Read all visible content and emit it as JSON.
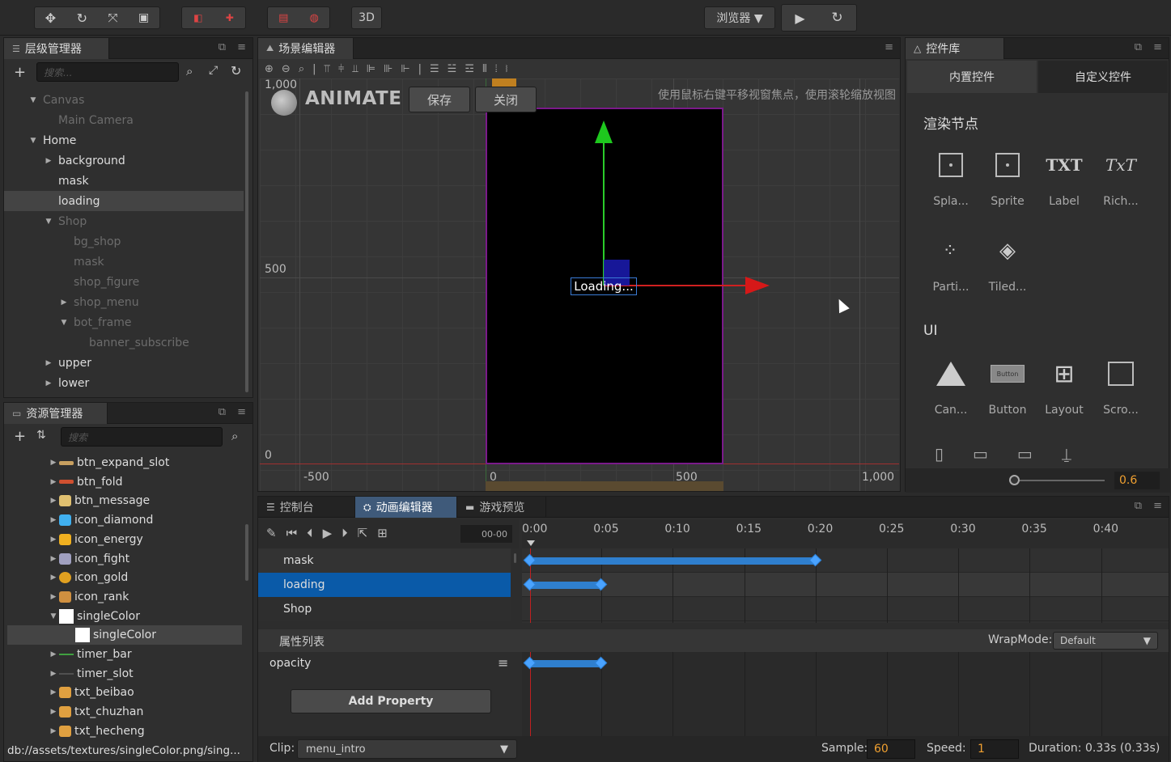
{
  "toolbar": {
    "view_3d": "3D",
    "browser_label": "浏览器 ▼"
  },
  "hierarchy": {
    "title": "层级管理器",
    "search_placeholder": "搜索...",
    "nodes": [
      {
        "label": "Canvas",
        "indent": 1,
        "arrow": "down",
        "dim": true
      },
      {
        "label": "Main Camera",
        "indent": 2,
        "arrow": "",
        "dim": true
      },
      {
        "label": "Home",
        "indent": 1,
        "arrow": "down",
        "dim": false
      },
      {
        "label": "background",
        "indent": 2,
        "arrow": "right",
        "dim": false
      },
      {
        "label": "mask",
        "indent": 2,
        "arrow": "",
        "dim": false
      },
      {
        "label": "loading",
        "indent": 2,
        "arrow": "",
        "dim": false,
        "selected": true
      },
      {
        "label": "Shop",
        "indent": 2,
        "arrow": "down",
        "dim": true
      },
      {
        "label": "bg_shop",
        "indent": 3,
        "arrow": "",
        "dim": true
      },
      {
        "label": "mask",
        "indent": 3,
        "arrow": "",
        "dim": true
      },
      {
        "label": "shop_figure",
        "indent": 3,
        "arrow": "",
        "dim": true
      },
      {
        "label": "shop_menu",
        "indent": 3,
        "arrow": "right",
        "dim": true
      },
      {
        "label": "bot_frame",
        "indent": 3,
        "arrow": "down",
        "dim": true
      },
      {
        "label": "banner_subscribe",
        "indent": 4,
        "arrow": "",
        "dim": true
      },
      {
        "label": "upper",
        "indent": 2,
        "arrow": "right",
        "dim": false
      },
      {
        "label": "lower",
        "indent": 2,
        "arrow": "right",
        "dim": false
      }
    ]
  },
  "assets": {
    "title": "资源管理器",
    "search_placeholder": "搜索",
    "items": [
      {
        "label": "btn_expand_slot",
        "icon": "bar",
        "color": "#c8a060"
      },
      {
        "label": "btn_fold",
        "icon": "bar",
        "color": "#d05030"
      },
      {
        "label": "btn_message",
        "icon": "box",
        "color": "#e0c070"
      },
      {
        "label": "icon_diamond",
        "icon": "gem",
        "color": "#40b0f0"
      },
      {
        "label": "icon_energy",
        "icon": "bolt",
        "color": "#f0b020"
      },
      {
        "label": "icon_fight",
        "icon": "sword",
        "color": "#a0a0c0"
      },
      {
        "label": "icon_gold",
        "icon": "coin",
        "color": "#e0a020"
      },
      {
        "label": "icon_rank",
        "icon": "crown",
        "color": "#d09040"
      },
      {
        "label": "singleColor",
        "icon": "white",
        "color": "#ffffff",
        "arrow": "down"
      },
      {
        "label": "singleColor",
        "icon": "white",
        "color": "#ffffff",
        "child": true,
        "selected": true
      },
      {
        "label": "timer_bar",
        "icon": "line",
        "color": "#40a040"
      },
      {
        "label": "timer_slot",
        "icon": "line",
        "color": "#505050"
      },
      {
        "label": "txt_beibao",
        "icon": "txt",
        "color": "#e0a040"
      },
      {
        "label": "txt_chuzhan",
        "icon": "txt",
        "color": "#e0a040"
      },
      {
        "label": "txt_hecheng",
        "icon": "txt",
        "color": "#e0a040"
      }
    ],
    "status_path": "db://assets/textures/singleColor.png/sing..."
  },
  "scene": {
    "title": "场景编辑器",
    "animate_label": "ANIMATE",
    "save_label": "保存",
    "close_label": "关闭",
    "hint": "使用鼠标右键平移视窗焦点，使用滚轮缩放视图",
    "ruler_y": [
      "1,000",
      "500",
      "0"
    ],
    "ruler_x": [
      "-500",
      "0",
      "500",
      "1,000"
    ],
    "loading_text": "Loading..."
  },
  "widgets": {
    "title": "控件库",
    "tab_builtin": "内置控件",
    "tab_custom": "自定义控件",
    "section_render": "渲染节点",
    "section_ui": "UI",
    "render_items": [
      "Spla...",
      "Sprite",
      "Label",
      "Rich...",
      "Parti...",
      "Tiled..."
    ],
    "ui_items": [
      "Can...",
      "Button",
      "Layout",
      "Scro..."
    ],
    "button_preview": "Button",
    "txt_glyph": "TXT",
    "rich_glyph": "TxT",
    "zoom_value": "0.6"
  },
  "bottom": {
    "tab_console": "控制台",
    "tab_animation": "动画编辑器",
    "tab_preview": "游戏预览",
    "time_display": "00-00",
    "time_labels": [
      "0:00",
      "0:05",
      "0:10",
      "0:15",
      "0:20",
      "0:25",
      "0:30",
      "0:35",
      "0:40"
    ],
    "tracks": [
      "mask",
      "loading",
      "Shop"
    ],
    "property_list_label": "属性列表",
    "wrapmode_label": "WrapMode:",
    "wrapmode_value": "Default",
    "property": "opacity",
    "add_property": "Add Property",
    "clip_label": "Clip:",
    "clip_value": "menu_intro",
    "sample_label": "Sample:",
    "sample_value": "60",
    "speed_label": "Speed:",
    "speed_value": "1",
    "duration": "Duration: 0.33s (0.33s)"
  }
}
